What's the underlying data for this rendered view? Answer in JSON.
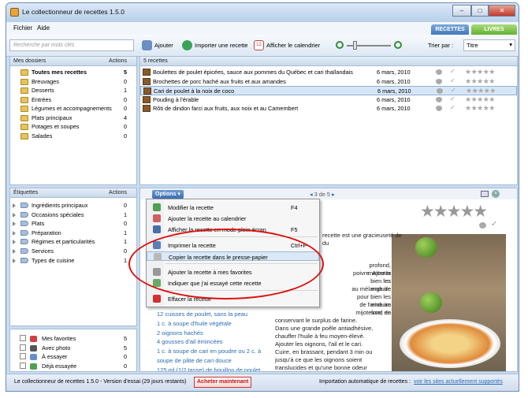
{
  "window": {
    "title": "Le collectionneur de recettes 1.5.0"
  },
  "menu": {
    "file": "Fichier",
    "help": "Aide"
  },
  "tabs": {
    "recipes": "RECETTES",
    "books": "LIVRES"
  },
  "toolbar": {
    "search_placeholder": "Recherche par mots clés",
    "add": "Ajouter",
    "import": "Importer une recette",
    "calendar": "Afficher le calendrier",
    "sort_label": "Trier par :",
    "sort_value": "Titre"
  },
  "folders": {
    "header": "Mes dossiers",
    "actions": "Actions",
    "items": [
      {
        "label": "Toutes mes recettes",
        "count": "5"
      },
      {
        "label": "Breuvages",
        "count": "0"
      },
      {
        "label": "Desserts",
        "count": "1"
      },
      {
        "label": "Entrées",
        "count": "0"
      },
      {
        "label": "Légumes et accompagnements",
        "count": "0"
      },
      {
        "label": "Plats principaux",
        "count": "4"
      },
      {
        "label": "Potages et soupes",
        "count": "0"
      },
      {
        "label": "Salades",
        "count": "0"
      }
    ]
  },
  "recipes": {
    "header": "5 recettes",
    "items": [
      {
        "name": "Boulettes de poulet épicées, sauce aux pommes du Québec et cari thaïlandais",
        "date": "6 mars, 2010"
      },
      {
        "name": "Brochettes de porc haché aux fruits et aux amandes",
        "date": "6 mars, 2010"
      },
      {
        "name": "Cari de poulet à la noix de coco",
        "date": "6 mars, 2010"
      },
      {
        "name": "Pouding à l'érable",
        "date": "6 mars, 2010"
      },
      {
        "name": "Rôti de dindon farci aux fruits, aux noix et au Camembert",
        "date": "6 mars, 2010"
      }
    ]
  },
  "labels": {
    "header": "Étiquettes",
    "actions": "Actions",
    "items": [
      {
        "label": "Ingrédients principaux",
        "count": "0"
      },
      {
        "label": "Occasions spéciales",
        "count": "1"
      },
      {
        "label": "Plats",
        "count": "0"
      },
      {
        "label": "Préparation",
        "count": "1"
      },
      {
        "label": "Régimes et particularités",
        "count": "1"
      },
      {
        "label": "Services",
        "count": "0"
      },
      {
        "label": "Types de cuisine",
        "count": "1"
      }
    ]
  },
  "smart": {
    "items": [
      {
        "label": "Mes favorites",
        "count": "5"
      },
      {
        "label": "Avec photo",
        "count": "5"
      },
      {
        "label": "À essayer",
        "count": "0"
      },
      {
        "label": "Déjà essayée",
        "count": "0"
      }
    ]
  },
  "detail": {
    "options": "Options",
    "pager": "3 de 5",
    "ingredients": [
      "12 cuisses de poulet, sans la peau",
      "1 c. à soupe d'huile végétale",
      "2 oignons hachés",
      "4 gousses d'ail émincées",
      "1 c. à soupe de cari en poudre ou 2 c. à",
      "soupe de pâte de cari douce",
      "125 ml (1/2 tasse) de bouillon de poulet"
    ],
    "desc1": [
      "recette est une gracieuseté de",
      "du"
    ],
    "desc2": [
      "profond, mettre la",
      "poivre. Ajouter les",
      "bien les enduire",
      "au mélange de",
      "pour bien les enduire",
      "de farine au fond de",
      "mijoteuse, en",
      "conservant le surplus de farine.",
      "Dans une grande poêle antiadhésive,",
      "chauffer l'huile à feu moyen-élevé.",
      "Ajouter les oignons, l'ail et le cari.",
      "Cuire, en brassant, pendant 3 min ou",
      "jusqu'à ce que les oignons soient",
      "translucides et qu'une bonne odeur",
      "s'en dégage. Saupoudrer de la farine"
    ]
  },
  "context_menu": {
    "items": [
      {
        "label": "Modifier la recette",
        "shortcut": "F4"
      },
      {
        "label": "Ajouter la recette au calendrier",
        "shortcut": ""
      },
      {
        "label": "Afficher la recette en mode plein écran",
        "shortcut": "F5"
      },
      {
        "label": "Imprimer la recette",
        "shortcut": "Ctrl+P"
      },
      {
        "label": "Copier la recette dans le presse-papier",
        "shortcut": ""
      },
      {
        "label": "Ajouter la recette à mes favorites",
        "shortcut": ""
      },
      {
        "label": "Indiquer que j'ai essayé cette recette",
        "shortcut": ""
      },
      {
        "label": "Effacer la recette",
        "shortcut": ""
      }
    ]
  },
  "status": {
    "version": "Le collectionneur de recettes 1.5.0 - Version d'essai (29 jours restants)",
    "buy": "Acheter maintenant",
    "import_label": "Importation automatique de recettes :",
    "sites_link": "voir les sites actuellement supportés"
  }
}
